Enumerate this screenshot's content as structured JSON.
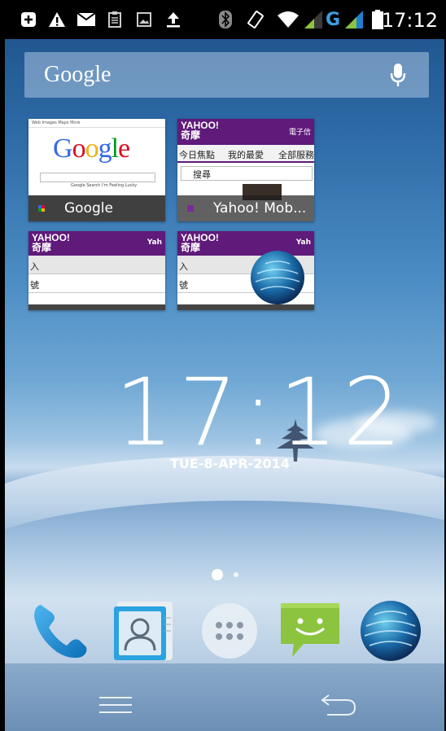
{
  "status_bar": {
    "time": "17:12",
    "network_type": "G",
    "icons": [
      "add-notification-icon",
      "warning-icon",
      "mail-icon",
      "clipboard-icon",
      "image-icon",
      "upload-icon",
      "bluetooth-icon",
      "rotation-icon",
      "wifi-icon",
      "signal-icon-1",
      "signal-icon-2",
      "battery-icon"
    ]
  },
  "search": {
    "logo": "Google",
    "icon": "mic-icon"
  },
  "recent_apps": [
    {
      "label": "Google",
      "thumb": "google",
      "google_logo": "Google",
      "buttons": "Google Search   I'm Feeling Lucky",
      "top_links": "Web  Images  Maps  More"
    },
    {
      "label": "Yahoo! Mob...",
      "thumb": "yahoo",
      "logo": "YAHOO! 奇摩",
      "tabs": [
        "今日焦點",
        "我的最愛",
        "全部服務"
      ],
      "search_text": "搜尋",
      "header_right": "電子信"
    },
    {
      "label": "",
      "thumb": "yahoo2",
      "logo": "YAHOO! 奇摩",
      "right": "Yah",
      "row1": "入",
      "row2": "號"
    },
    {
      "label": "",
      "thumb": "yahoo3",
      "logo": "YAHOO! 奇摩",
      "right": "Yah",
      "row1": "入",
      "row2": "號"
    }
  ],
  "clock": {
    "time": "17:12",
    "date": "TUE-8-APR-2014"
  },
  "pager": {
    "pages": 2,
    "current": 1
  },
  "dock": [
    "phone-icon",
    "contacts-icon",
    "app-drawer-icon",
    "messaging-icon",
    "browser-globe-icon"
  ],
  "colors": {
    "status_bar": "#000000",
    "yahoo_purple": "#5f1a7a",
    "accent_green": "#8cc43f",
    "phone_blue": "#1f8fd8"
  }
}
